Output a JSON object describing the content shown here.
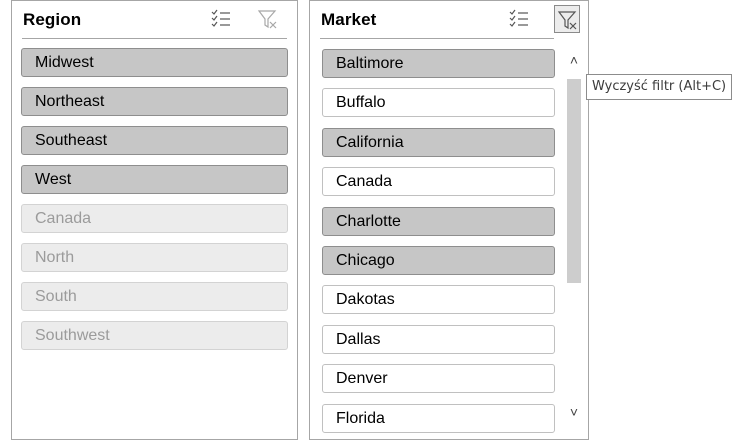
{
  "region_slicer": {
    "title": "Region",
    "multiselect_icon": "multi-select-icon",
    "clear_filter_icon": "clear-filter-icon",
    "items": [
      {
        "label": "Midwest",
        "state": "selected"
      },
      {
        "label": "Northeast",
        "state": "selected"
      },
      {
        "label": "Southeast",
        "state": "selected"
      },
      {
        "label": "West",
        "state": "selected"
      },
      {
        "label": "Canada",
        "state": "no-data"
      },
      {
        "label": "North",
        "state": "no-data"
      },
      {
        "label": "South",
        "state": "no-data"
      },
      {
        "label": "Southwest",
        "state": "no-data"
      }
    ]
  },
  "market_slicer": {
    "title": "Market",
    "multiselect_icon": "multi-select-icon",
    "clear_filter_icon": "clear-filter-icon",
    "items": [
      {
        "label": "Baltimore",
        "state": "selected"
      },
      {
        "label": "Buffalo",
        "state": "unselected"
      },
      {
        "label": "California",
        "state": "selected"
      },
      {
        "label": "Canada",
        "state": "unselected"
      },
      {
        "label": "Charlotte",
        "state": "selected"
      },
      {
        "label": "Chicago",
        "state": "selected"
      },
      {
        "label": "Dakotas",
        "state": "unselected"
      },
      {
        "label": "Dallas",
        "state": "unselected"
      },
      {
        "label": "Denver",
        "state": "unselected"
      },
      {
        "label": "Florida",
        "state": "unselected"
      }
    ],
    "scrollbar": {
      "up_icon": "chevron-up-icon",
      "down_icon": "chevron-down-icon"
    }
  },
  "tooltip": {
    "text": "Wyczyść filtr (Alt+C)"
  },
  "colors": {
    "selected_item": "#c6c6c6",
    "no_data_text": "#9b9b9b",
    "border": "#a6a6a6"
  }
}
